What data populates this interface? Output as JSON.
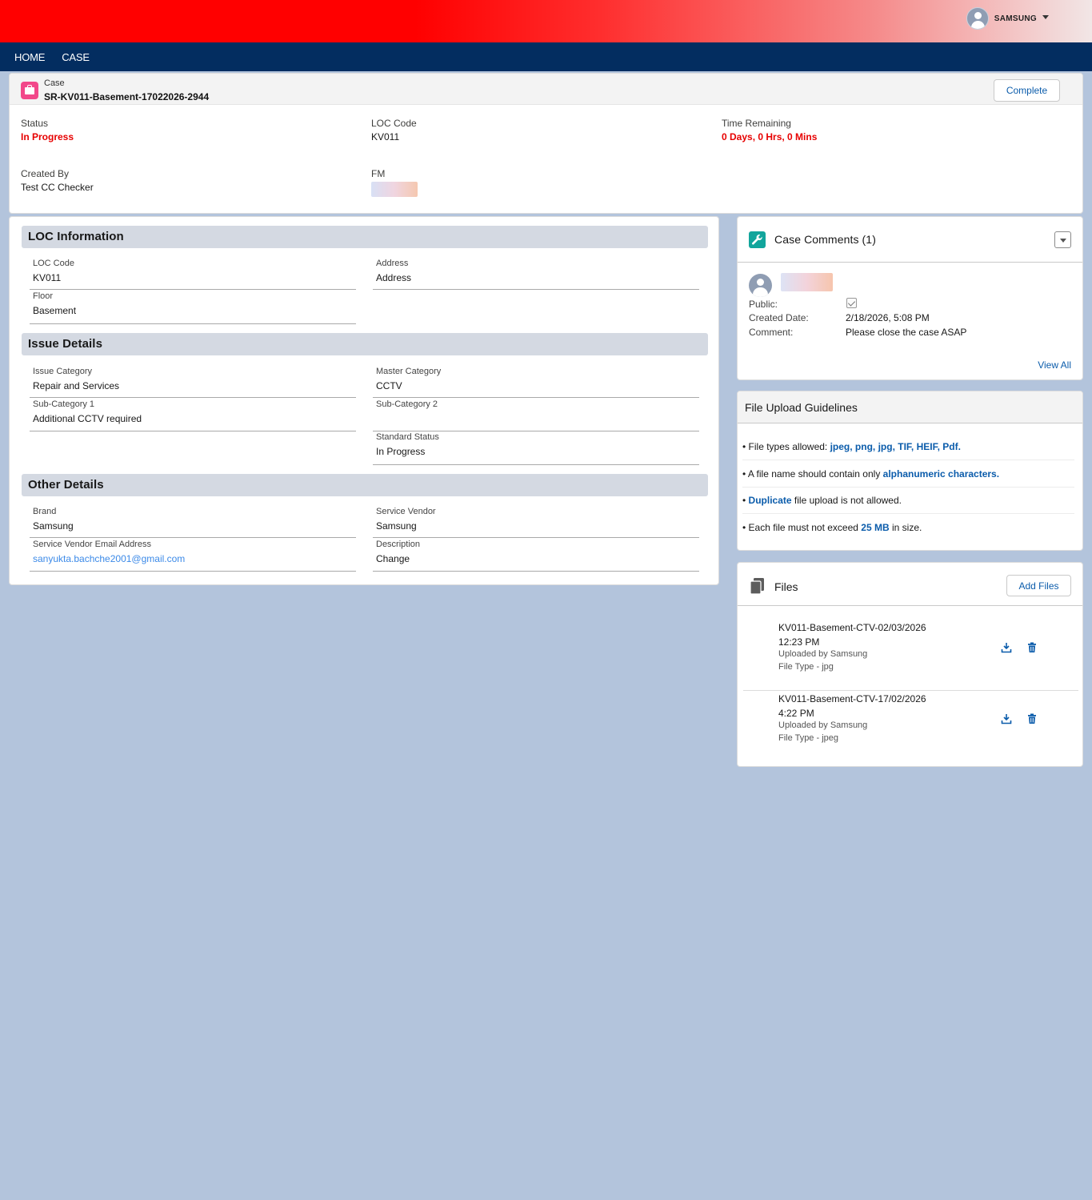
{
  "header": {
    "user_name": "SAMSUNG"
  },
  "nav": {
    "items": [
      "HOME",
      "CASE"
    ]
  },
  "case": {
    "type_label": "Case",
    "number": "SR-KV011-Basement-17022026-2944",
    "complete_label": "Complete",
    "status_label": "Status",
    "status_value": "In Progress",
    "loc_code_label": "LOC Code",
    "loc_code_value": "KV011",
    "time_remaining_label": "Time Remaining",
    "time_remaining_value": "0 Days, 0 Hrs, 0 Mins",
    "created_by_label": "Created By",
    "created_by_value": "Test CC Checker",
    "fm_label": "FM"
  },
  "loc_info": {
    "title": "LOC Information",
    "loc_code_label": "LOC Code",
    "loc_code_value": "KV011",
    "address_label": "Address",
    "address_value": "Address",
    "floor_label": "Floor",
    "floor_value": "Basement"
  },
  "issue_details": {
    "title": "Issue Details",
    "issue_category_label": "Issue Category",
    "issue_category_value": "Repair and Services",
    "master_category_label": "Master Category",
    "master_category_value": "CCTV",
    "sub_category1_label": "Sub-Category 1",
    "sub_category1_value": "Additional CCTV required",
    "sub_category2_label": "Sub-Category 2",
    "sub_category2_value": "",
    "standard_status_label": "Standard Status",
    "standard_status_value": "In Progress"
  },
  "other_details": {
    "title": "Other Details",
    "brand_label": "Brand",
    "brand_value": "Samsung",
    "service_vendor_label": "Service Vendor",
    "service_vendor_value": "Samsung",
    "vendor_email_label": "Service Vendor Email Address",
    "vendor_email_value": "sanyukta.bachche2001@gmail.com",
    "description_label": "Description",
    "description_value": "Change"
  },
  "comments": {
    "title": "Case Comments (1)",
    "public_label": "Public:",
    "created_date_label": "Created Date:",
    "created_date_value": "2/18/2026, 5:08 PM",
    "comment_label": "Comment:",
    "comment_value": "Please close the case ASAP",
    "view_all": "View All"
  },
  "guidelines": {
    "title": "File Upload Guidelines",
    "item1_pre": "File types allowed: ",
    "item1_hl": "jpeg, png, jpg, TIF, HEIF, Pdf.",
    "item2_pre": "A file name should contain only ",
    "item2_hl": "alphanumeric characters.",
    "item3_hl": "Duplicate",
    "item3_post": " file upload is not allowed.",
    "item4_pre": "Each file must not exceed ",
    "item4_hl": "25 MB",
    "item4_post": " in size."
  },
  "files": {
    "title": "Files",
    "add_label": "Add Files",
    "items": [
      {
        "name_line1": "KV011-Basement-CTV-02/03/2026",
        "name_line2": "12:23 PM",
        "uploaded_by": "Uploaded by Samsung",
        "file_type": "File Type - jpg"
      },
      {
        "name_line1": "KV011-Basement-CTV-17/02/2026",
        "name_line2": "4:22 PM",
        "uploaded_by": "Uploaded by Samsung",
        "file_type": "File Type - jpeg"
      }
    ]
  },
  "colors": {
    "accent": "#0b5cab",
    "status_red": "#e70000",
    "nav": "#032d60",
    "background": "#b3c4dc"
  }
}
